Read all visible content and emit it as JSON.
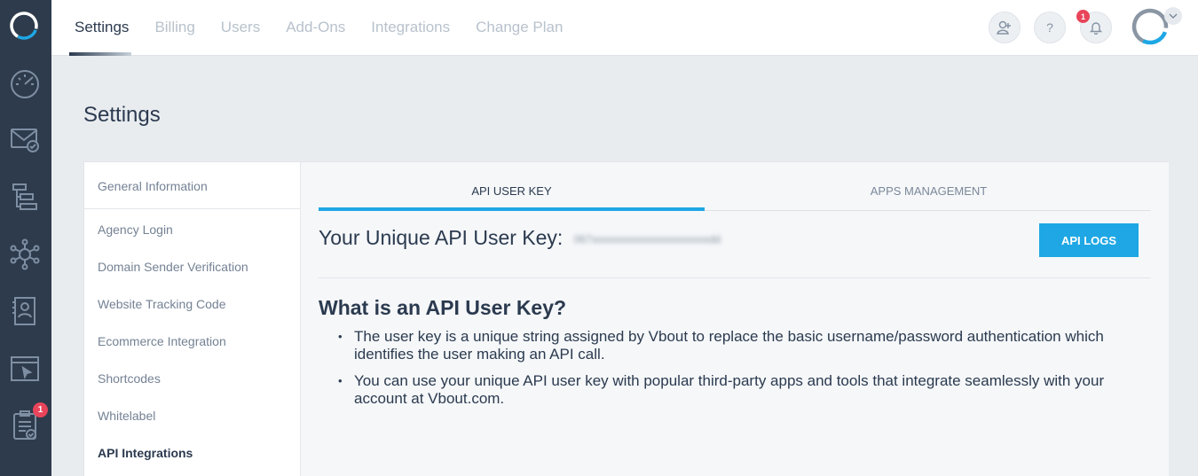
{
  "top_nav": {
    "tabs": [
      "Settings",
      "Billing",
      "Users",
      "Add-Ons",
      "Integrations",
      "Change Plan"
    ],
    "help_label": "?",
    "notification_count": "1"
  },
  "left_rail": {
    "badge_count": "1",
    "icons": [
      "dashboard-icon",
      "email-icon",
      "workflow-icon",
      "network-icon",
      "contacts-icon",
      "website-icon",
      "tasks-icon"
    ]
  },
  "page": {
    "title": "Settings"
  },
  "sidebar": {
    "items": [
      {
        "label": "General Information"
      },
      {
        "label": "Agency Login"
      },
      {
        "label": "Domain Sender Verification"
      },
      {
        "label": "Website Tracking Code"
      },
      {
        "label": "Ecommerce Integration"
      },
      {
        "label": "Shortcodes"
      },
      {
        "label": "Whitelabel"
      },
      {
        "label": "API Integrations"
      }
    ]
  },
  "content": {
    "tabs": [
      "API USER KEY",
      "APPS MANAGEMENT"
    ],
    "key_label": "Your Unique API User Key:",
    "key_value": "067xxxxxxxxxxxxxxxxxxxxxxdd",
    "api_logs_button": "API LOGS",
    "what_title": "What is an API User Key?",
    "bullets": [
      "The user key is a unique string assigned by Vbout to replace the basic username/password authentication which identifies the user making an API call.",
      "You can use your unique API user key with popular third-party apps and tools that integrate seamlessly with your account at Vbout.com."
    ]
  },
  "colors": {
    "rail": "#2e3b4c",
    "accent": "#1ea7e4",
    "badge": "#e8445a",
    "text": "#2b3a4f"
  }
}
